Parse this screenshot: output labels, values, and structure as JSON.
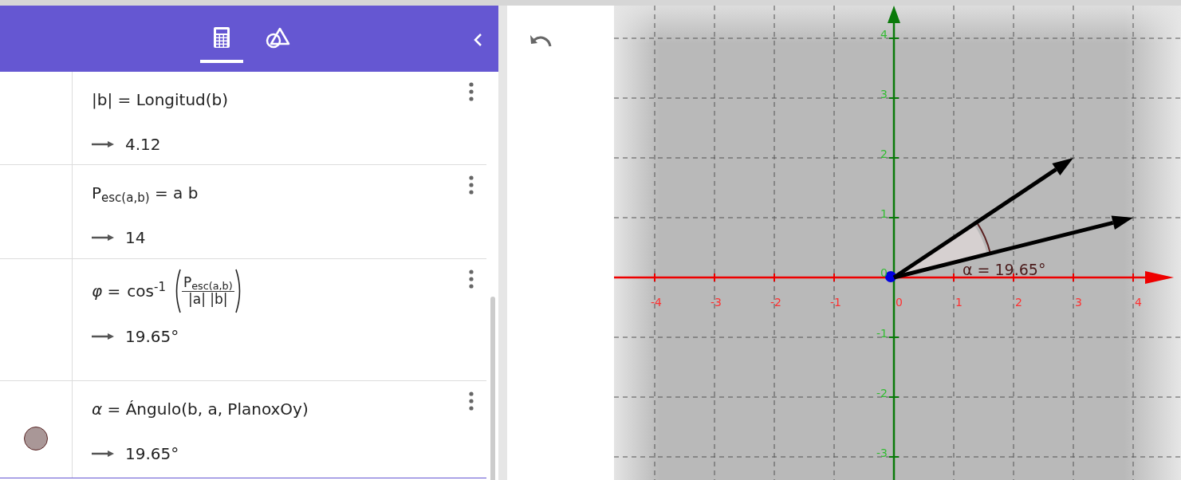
{
  "header": {
    "tabs": [
      {
        "kind": "calculator",
        "selected": true
      },
      {
        "kind": "geometry",
        "selected": false
      }
    ]
  },
  "algebra": [
    {
      "kind": "plain",
      "definition": "|b| = Longitud(b)",
      "output": "4.12",
      "visible": false,
      "selected": false
    },
    {
      "kind": "plain",
      "definition": "P$_{esc(a,b)}$ = a b",
      "output": "14",
      "visible": false,
      "selected": false
    },
    {
      "kind": "fraction",
      "lhs": "*φ* =",
      "function": "cos$^{-1}$",
      "numerator": "P$_{esc(a,b)}$",
      "denominator": "|a| |b|",
      "output": "19.65°",
      "visible": false,
      "selected": false
    },
    {
      "kind": "plain",
      "definition": "*α* = Ángulo(b, a, PlanoxOy)",
      "output": "19.65°",
      "visible": true,
      "color": "#a99797",
      "selected": true
    }
  ],
  "graphics": {
    "x_labels": [
      "-4",
      "-3",
      "-2",
      "-1",
      "0",
      "1",
      "2",
      "3",
      "4"
    ],
    "y_labels": [
      "4",
      "3",
      "2",
      "1",
      "0",
      "-1",
      "-2",
      "-3"
    ],
    "angle_label": "α = 19.65°"
  }
}
